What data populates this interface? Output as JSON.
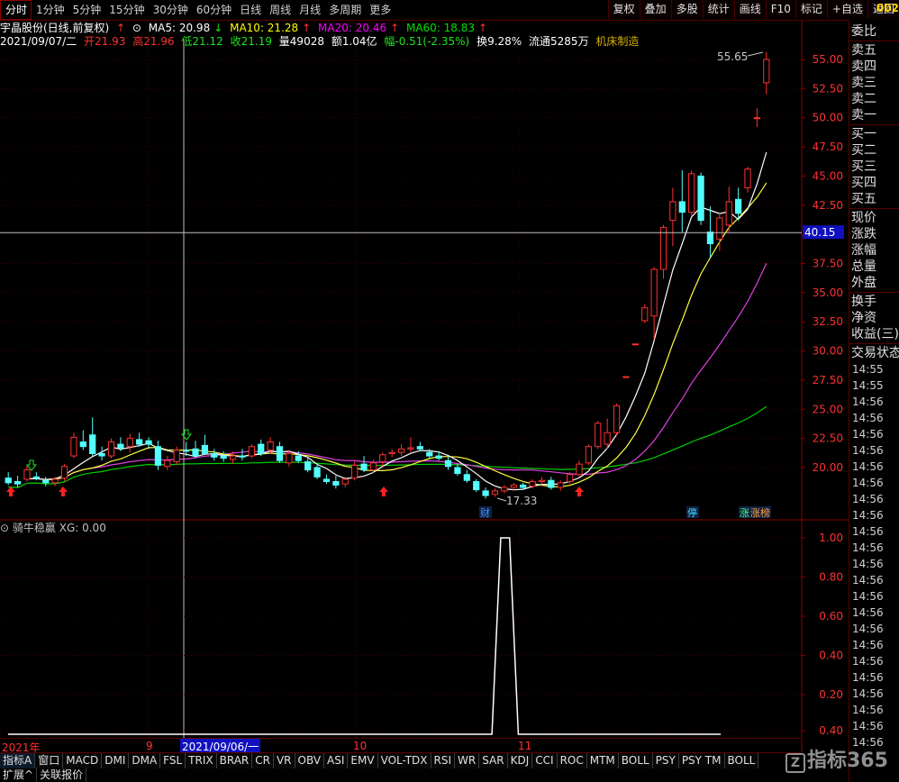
{
  "topbar": {
    "tabs": [
      "分时",
      "1分钟",
      "5分钟",
      "15分钟",
      "30分钟",
      "60分钟",
      "日线",
      "周线",
      "月线",
      "多周期",
      "更多"
    ],
    "active_tab": "分时",
    "buttons": [
      "复权",
      "叠加",
      "多股",
      "统计",
      "画线",
      "F10",
      "标记",
      "+自选",
      "返回"
    ],
    "code_partial": "002"
  },
  "info": {
    "stock": "宇晶股份(日线,前复权)",
    "ma5": "MA5: 20.98",
    "ma10": "MA10: 21.28",
    "ma20": "MA20: 20.46",
    "ma60": "MA60: 18.83",
    "date": "2021/09/07/二",
    "open": "开21.93",
    "high": "高21.96",
    "low": "低21.12",
    "close": "收21.19",
    "volume": "量49028",
    "amount": "额1.04亿",
    "change": "幅-0.51(-2.35%)",
    "turnover": "换9.28%",
    "float": "流通5285万",
    "sector": "机床制造"
  },
  "side_panel": {
    "group1": [
      "委比"
    ],
    "group2": [
      "卖五",
      "卖四",
      "卖三",
      "卖二",
      "卖一"
    ],
    "group3": [
      "买一",
      "买二",
      "买三",
      "买四",
      "买五"
    ],
    "group4": [
      "现价",
      "涨跌",
      "涨幅",
      "总量",
      "外盘"
    ],
    "group5": [
      "换手",
      "净资",
      "收益(三)"
    ],
    "group6": [
      "交易状态"
    ],
    "times": [
      "14:55",
      "14:55",
      "14:56",
      "14:56",
      "14:56",
      "14:56",
      "14:56",
      "14:56",
      "14:56",
      "14:56",
      "14:56",
      "14:56",
      "14:56",
      "14:56",
      "14:56",
      "14:56",
      "14:56",
      "14:56",
      "14:56",
      "14:56",
      "14:56",
      "14:56",
      "14:56",
      "14:56"
    ]
  },
  "main_chart": {
    "price_ticks": [
      "55.00",
      "52.50",
      "50.00",
      "47.50",
      "45.00",
      "42.50",
      "40.00",
      "37.50",
      "35.00",
      "32.50",
      "30.00",
      "27.50",
      "25.00",
      "22.50",
      "20.00"
    ],
    "crosshair_price": "40.15",
    "high_label": "55.65",
    "low_label": "17.33",
    "badges": [
      "财",
      "停",
      "涨",
      "涨榜"
    ]
  },
  "indicator": {
    "name": "骑牛稳赢",
    "xg": "XG: 0.00",
    "ticks": [
      "1.00",
      "0.80",
      "0.60",
      "0.40",
      "0.20",
      "0.40"
    ]
  },
  "date_axis": {
    "labels": [
      "2021年",
      "9",
      "2021/09/06/一",
      "10",
      "11"
    ]
  },
  "indicator_tabs": [
    "指标A",
    "窗口",
    "MACD",
    "DMI",
    "DMA",
    "FSL",
    "TRIX",
    "BRAR",
    "CR",
    "VR",
    "OBV",
    "ASI",
    "EMV",
    "VOL-TDX",
    "RSI",
    "WR",
    "SAR",
    "KDJ",
    "CCI",
    "ROC",
    "MTM",
    "BOLL",
    "PSY",
    "PSY TM",
    "BOLL"
  ],
  "bottom_tabs": [
    "扩展^",
    "关联报价"
  ],
  "watermark": "指标365",
  "chart_data": {
    "type": "candlestick",
    "ylim": [
      17,
      56
    ],
    "candles": [
      {
        "o": 19.1,
        "h": 19.6,
        "l": 18.5,
        "c": 18.7
      },
      {
        "o": 18.8,
        "h": 19.3,
        "l": 18.3,
        "c": 18.6
      },
      {
        "o": 19.0,
        "h": 20.2,
        "l": 18.8,
        "c": 19.8
      },
      {
        "o": 19.2,
        "h": 19.6,
        "l": 18.9,
        "c": 19.1
      },
      {
        "o": 18.9,
        "h": 19.2,
        "l": 18.4,
        "c": 18.7
      },
      {
        "o": 18.7,
        "h": 19.2,
        "l": 18.4,
        "c": 19.0
      },
      {
        "o": 19.1,
        "h": 20.3,
        "l": 18.8,
        "c": 20.1
      },
      {
        "o": 21.0,
        "h": 23.0,
        "l": 20.8,
        "c": 22.6
      },
      {
        "o": 22.2,
        "h": 23.2,
        "l": 21.5,
        "c": 21.8
      },
      {
        "o": 22.8,
        "h": 24.3,
        "l": 21.0,
        "c": 21.2
      },
      {
        "o": 21.2,
        "h": 21.8,
        "l": 20.6,
        "c": 21.0
      },
      {
        "o": 21.0,
        "h": 22.5,
        "l": 20.8,
        "c": 22.2
      },
      {
        "o": 22.0,
        "h": 22.6,
        "l": 21.4,
        "c": 21.7
      },
      {
        "o": 21.8,
        "h": 22.9,
        "l": 21.3,
        "c": 22.5
      },
      {
        "o": 22.4,
        "h": 23.0,
        "l": 21.8,
        "c": 22.0
      },
      {
        "o": 22.3,
        "h": 22.6,
        "l": 21.6,
        "c": 22.0
      },
      {
        "o": 21.8,
        "h": 22.3,
        "l": 19.8,
        "c": 20.2
      },
      {
        "o": 20.1,
        "h": 21.0,
        "l": 19.8,
        "c": 20.6
      },
      {
        "o": 20.5,
        "h": 21.8,
        "l": 20.2,
        "c": 21.5
      },
      {
        "o": 21.5,
        "h": 22.2,
        "l": 21.0,
        "c": 21.4
      },
      {
        "o": 21.6,
        "h": 22.3,
        "l": 20.8,
        "c": 21.0
      },
      {
        "o": 21.9,
        "h": 22.8,
        "l": 21.1,
        "c": 21.2
      },
      {
        "o": 21.2,
        "h": 21.6,
        "l": 20.6,
        "c": 20.9
      },
      {
        "o": 21.0,
        "h": 21.4,
        "l": 20.5,
        "c": 20.8
      },
      {
        "o": 20.7,
        "h": 21.4,
        "l": 20.3,
        "c": 21.0
      },
      {
        "o": 21.0,
        "h": 21.6,
        "l": 20.6,
        "c": 20.9
      },
      {
        "o": 21.0,
        "h": 22.0,
        "l": 20.8,
        "c": 21.8
      },
      {
        "o": 22.0,
        "h": 22.4,
        "l": 21.0,
        "c": 21.2
      },
      {
        "o": 21.5,
        "h": 22.6,
        "l": 21.2,
        "c": 22.2
      },
      {
        "o": 21.8,
        "h": 22.2,
        "l": 20.4,
        "c": 20.6
      },
      {
        "o": 20.4,
        "h": 21.5,
        "l": 20.1,
        "c": 21.2
      },
      {
        "o": 21.0,
        "h": 21.4,
        "l": 20.4,
        "c": 20.6
      },
      {
        "o": 20.5,
        "h": 20.8,
        "l": 19.6,
        "c": 19.8
      },
      {
        "o": 20.0,
        "h": 20.4,
        "l": 19.0,
        "c": 19.2
      },
      {
        "o": 19.0,
        "h": 19.4,
        "l": 18.6,
        "c": 18.8
      },
      {
        "o": 18.8,
        "h": 19.3,
        "l": 18.2,
        "c": 18.5
      },
      {
        "o": 18.6,
        "h": 19.2,
        "l": 18.3,
        "c": 19.0
      },
      {
        "o": 19.1,
        "h": 20.5,
        "l": 18.9,
        "c": 20.2
      },
      {
        "o": 20.3,
        "h": 21.0,
        "l": 19.6,
        "c": 19.8
      },
      {
        "o": 19.8,
        "h": 20.7,
        "l": 19.5,
        "c": 20.4
      },
      {
        "o": 20.5,
        "h": 21.3,
        "l": 20.1,
        "c": 21.1
      },
      {
        "o": 21.2,
        "h": 21.6,
        "l": 20.9,
        "c": 21.3
      },
      {
        "o": 21.3,
        "h": 22.0,
        "l": 21.0,
        "c": 21.6
      },
      {
        "o": 21.6,
        "h": 22.6,
        "l": 21.3,
        "c": 21.7
      },
      {
        "o": 21.8,
        "h": 22.2,
        "l": 21.4,
        "c": 21.6
      },
      {
        "o": 21.3,
        "h": 21.6,
        "l": 20.8,
        "c": 21.0
      },
      {
        "o": 21.0,
        "h": 21.4,
        "l": 20.6,
        "c": 20.8
      },
      {
        "o": 20.6,
        "h": 20.9,
        "l": 19.8,
        "c": 20.1
      },
      {
        "o": 20.0,
        "h": 20.3,
        "l": 19.3,
        "c": 19.5
      },
      {
        "o": 19.4,
        "h": 19.8,
        "l": 18.7,
        "c": 18.9
      },
      {
        "o": 18.8,
        "h": 19.0,
        "l": 17.9,
        "c": 18.1
      },
      {
        "o": 18.0,
        "h": 18.3,
        "l": 17.33,
        "c": 17.6
      },
      {
        "o": 17.7,
        "h": 18.2,
        "l": 17.5,
        "c": 18.0
      },
      {
        "o": 18.0,
        "h": 18.5,
        "l": 17.8,
        "c": 18.3
      },
      {
        "o": 18.3,
        "h": 18.7,
        "l": 18.0,
        "c": 18.5
      },
      {
        "o": 18.5,
        "h": 18.7,
        "l": 18.1,
        "c": 18.3
      },
      {
        "o": 18.4,
        "h": 19.0,
        "l": 18.2,
        "c": 18.8
      },
      {
        "o": 18.8,
        "h": 19.2,
        "l": 18.5,
        "c": 18.9
      },
      {
        "o": 18.9,
        "h": 19.2,
        "l": 18.1,
        "c": 18.3
      },
      {
        "o": 18.3,
        "h": 18.9,
        "l": 18.0,
        "c": 18.7
      },
      {
        "o": 18.8,
        "h": 19.6,
        "l": 18.6,
        "c": 19.4
      },
      {
        "o": 19.4,
        "h": 20.6,
        "l": 19.2,
        "c": 20.3
      },
      {
        "o": 20.4,
        "h": 22.0,
        "l": 20.2,
        "c": 21.8
      },
      {
        "o": 21.8,
        "h": 24.0,
        "l": 21.6,
        "c": 23.8
      },
      {
        "o": 22.0,
        "h": 24.2,
        "l": 21.6,
        "c": 23.0
      },
      {
        "o": 23.0,
        "h": 25.5,
        "l": 22.8,
        "c": 25.3
      },
      {
        "o": 27.8,
        "h": 27.8,
        "l": 27.8,
        "c": 27.8
      },
      {
        "o": 30.6,
        "h": 30.6,
        "l": 30.6,
        "c": 30.6
      },
      {
        "o": 32.6,
        "h": 34.0,
        "l": 32.4,
        "c": 33.7
      },
      {
        "o": 33.0,
        "h": 37.2,
        "l": 31.0,
        "c": 37.0
      },
      {
        "o": 37.0,
        "h": 40.8,
        "l": 36.2,
        "c": 40.6
      },
      {
        "o": 41.2,
        "h": 44.0,
        "l": 39.0,
        "c": 42.8
      },
      {
        "o": 42.8,
        "h": 45.5,
        "l": 40.2,
        "c": 41.9
      },
      {
        "o": 41.9,
        "h": 45.5,
        "l": 41.6,
        "c": 45.2
      },
      {
        "o": 45.0,
        "h": 45.3,
        "l": 40.8,
        "c": 41.2
      },
      {
        "o": 40.2,
        "h": 42.4,
        "l": 38.0,
        "c": 39.2
      },
      {
        "o": 39.6,
        "h": 41.8,
        "l": 38.6,
        "c": 41.4
      },
      {
        "o": 40.8,
        "h": 44.1,
        "l": 40.2,
        "c": 42.8
      },
      {
        "o": 43.0,
        "h": 44.0,
        "l": 41.2,
        "c": 41.8
      },
      {
        "o": 44.0,
        "h": 45.8,
        "l": 43.6,
        "c": 45.6
      },
      {
        "o": 50.0,
        "h": 50.8,
        "l": 49.2,
        "c": 50.0
      },
      {
        "o": 53.0,
        "h": 55.65,
        "l": 52.0,
        "c": 55.0
      }
    ],
    "indicator_series": {
      "name": "XG",
      "values_peak_index": 56,
      "values": [
        0,
        0,
        0,
        0,
        0,
        0,
        0,
        0,
        0,
        0,
        0,
        0,
        0,
        0,
        0,
        0,
        0,
        0,
        0,
        0,
        0,
        0,
        0,
        0,
        0,
        0,
        0,
        0,
        0,
        0,
        0,
        0,
        0,
        0,
        0,
        0,
        0,
        0,
        0,
        0,
        0,
        0,
        0,
        0,
        0,
        0,
        0,
        0,
        0,
        0,
        0,
        0,
        0,
        0,
        0,
        0,
        1,
        1,
        0,
        0,
        0,
        0,
        0,
        0,
        0,
        0,
        0,
        0,
        0,
        0,
        0,
        0,
        0,
        0,
        0,
        0,
        0,
        0,
        0,
        0,
        0,
        0
      ]
    }
  }
}
